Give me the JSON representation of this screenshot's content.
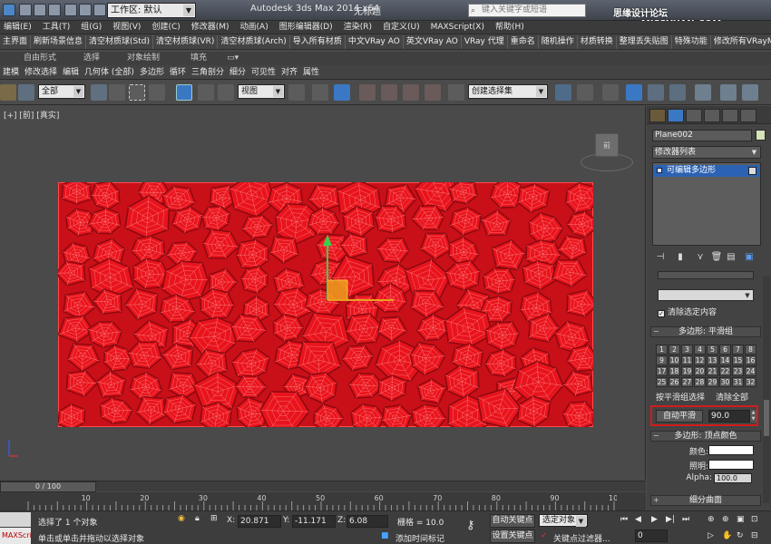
{
  "titlebar": {
    "workspace": "工作区: 默认",
    "app_title": "Autodesk 3ds Max  2014 x64",
    "doc_name": "无标题",
    "search_placeholder": "键入关键字或短语",
    "watermark": "思缘设计论坛 www.MISSYUAN.COM"
  },
  "menus": [
    "编辑(E)",
    "工具(T)",
    "组(G)",
    "视图(V)",
    "创建(C)",
    "修改器(M)",
    "动画(A)",
    "图形编辑器(D)",
    "渲染(R)",
    "自定义(U)",
    "MAXScript(X)",
    "帮助(H)"
  ],
  "custom_toolbar": [
    "主界面",
    "刷新场景信息",
    "清空材质球(Std)",
    "清空材质球(VR)",
    "清空材质球(Arch)",
    "导入所有材质",
    "中文VRay AO",
    "英文VRay AO",
    "VRay 代理",
    "重命名",
    "随机操作",
    "材质转换",
    "整理丢失贴图",
    "特殊功能",
    "修改所有VRayMtl"
  ],
  "ribbon_tabs": [
    "自由形式",
    "选择",
    "对象绘制",
    "填充"
  ],
  "ribbon_tools": [
    "建模",
    "修改选择",
    "编辑",
    "几何体 (全部)",
    "多边形",
    "循环",
    "三角剖分",
    "细分",
    "可见性",
    "对齐",
    "属性"
  ],
  "main_toolbar": {
    "filter_select": "全部",
    "ref_coord": "视图",
    "named_selection": "创建选择集"
  },
  "viewport": {
    "label": "[+] [前] [真实]",
    "viewcube_label": "前"
  },
  "timeline": {
    "slider": "0 / 100",
    "ticks": [
      "10",
      "20",
      "30",
      "40",
      "50",
      "60",
      "70",
      "80",
      "90",
      "100"
    ]
  },
  "status": {
    "maxscript_label": "MAXScri",
    "selection_info": "选择了 1 个对象",
    "prompt": "单击或单击并拖动以选择对象",
    "x_label": "X:",
    "x_value": "20.871",
    "y_label": "Y:",
    "y_value": "-11.171",
    "z_label": "Z:",
    "z_value": "6.08",
    "grid": "栅格 = 10.0",
    "add_time_tag": "添加时间标记",
    "auto_key": "自动关键点",
    "set_key": "设置关键点",
    "selected_object": "选定对象",
    "key_filters": "关键点过滤器...",
    "frame_value": "0"
  },
  "command_panel": {
    "object_name": "Plane002",
    "object_color": "#d5e3b6",
    "modifier_list": "修改器列表",
    "stack_item": "可编辑多边形",
    "clear_selection": "清除选定内容",
    "smoothing_header": "多边形: 平滑组",
    "smoothing_groups": [
      "1",
      "2",
      "3",
      "4",
      "5",
      "6",
      "7",
      "8",
      "9",
      "10",
      "11",
      "12",
      "13",
      "14",
      "15",
      "16",
      "17",
      "18",
      "19",
      "20",
      "21",
      "22",
      "23",
      "24",
      "25",
      "26",
      "27",
      "28",
      "29",
      "30",
      "31",
      "32"
    ],
    "select_by_sg": "按平滑组选择",
    "clear_all": "清除全部",
    "auto_smooth": "自动平滑",
    "auto_smooth_value": "90.0",
    "vertex_colors_header": "多边形: 顶点颜色",
    "color_label": "颜色:",
    "illum_label": "照明:",
    "alpha_label": "Alpha:",
    "alpha_value": "100.0",
    "subdiv_header": "细分曲面"
  },
  "colors": {
    "plane_red": "#e8141d",
    "highlight_red": "#d21c1c",
    "selection_blue": "#2c62b3"
  }
}
